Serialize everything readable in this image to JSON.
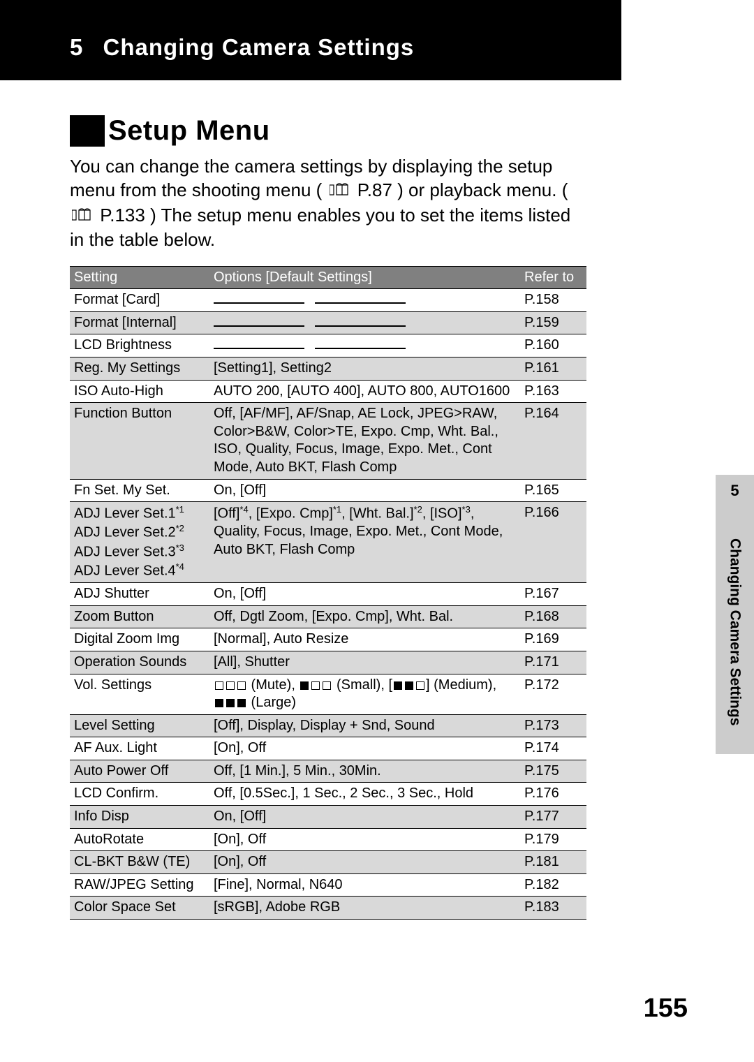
{
  "chapter": {
    "number": "5",
    "title": "Changing Camera Settings"
  },
  "section": {
    "title": "Setup Menu"
  },
  "intro": {
    "part1": "You can change the camera settings by displaying the setup menu from the shooting menu (",
    "ref1": "P.87",
    "part2": ") or playback menu. (",
    "ref2": "P.133",
    "part3": ") The setup menu enables you to set the items listed in the table below."
  },
  "table": {
    "headers": {
      "setting": "Setting",
      "options": "Options [Default Settings]",
      "refer": "Refer to"
    },
    "rows": [
      {
        "setting": "Format [Card]",
        "options": "__dash__",
        "refer": "P.158"
      },
      {
        "setting": "Format [Internal]",
        "options": "__dash__",
        "refer": "P.159"
      },
      {
        "setting": "LCD Brightness",
        "options": "__dash__",
        "refer": "P.160"
      },
      {
        "setting": "Reg. My Settings",
        "options": "[Setting1], Setting2",
        "refer": "P.161"
      },
      {
        "setting": "ISO Auto-High",
        "options": "AUTO 200, [AUTO 400], AUTO 800, AUTO1600",
        "refer": "P.163"
      },
      {
        "setting": "Function Button",
        "options": "Off, [AF/MF], AF/Snap, AE Lock, JPEG>RAW, Color>B&W, Color>TE, Expo. Cmp, Wht. Bal., ISO, Quality, Focus, Image, Expo. Met., Cont Mode, Auto BKT, Flash Comp",
        "refer": "P.164"
      },
      {
        "setting": "Fn Set. My Set.",
        "options": "On, [Off]",
        "refer": "P.165"
      },
      {
        "setting_html": "ADJ Lever Set.1<span class='sup'>*1</span><br>ADJ Lever Set.2<span class='sup'>*2</span><br>ADJ Lever Set.3<span class='sup'>*3</span><br>ADJ Lever Set.4<span class='sup'>*4</span>",
        "options_html": "[Off]<span class='sup'>*4</span>, [Expo. Cmp]<span class='sup'>*1</span>, [Wht. Bal.]<span class='sup'>*2</span>, [ISO]<span class='sup'>*3</span>, Quality, Focus, Image, Expo. Met., Cont Mode, Auto BKT, Flash Comp",
        "refer": "P.166"
      },
      {
        "setting": "ADJ Shutter",
        "options": "On, [Off]",
        "refer": "P.167"
      },
      {
        "setting": "Zoom Button",
        "options": "Off, Dgtl Zoom, [Expo. Cmp], Wht. Bal.",
        "refer": "P.168"
      },
      {
        "setting": "Digital Zoom Img",
        "options": "[Normal], Auto Resize",
        "refer": "P.169"
      },
      {
        "setting": "Operation Sounds",
        "options": "[All], Shutter",
        "refer": "P.171"
      },
      {
        "setting": "Vol. Settings",
        "options": "__vol__",
        "refer": "P.172",
        "vol_labels": {
          "mute": "(Mute),",
          "small": "(Small),",
          "medium": "(Medium),",
          "large": "(Large)"
        }
      },
      {
        "setting": "Level Setting",
        "options": "[Off], Display, Display + Snd, Sound",
        "refer": "P.173"
      },
      {
        "setting": "AF Aux. Light",
        "options": "[On], Off",
        "refer": "P.174"
      },
      {
        "setting": "Auto Power Off",
        "options": "Off, [1 Min.], 5 Min., 30Min.",
        "refer": "P.175"
      },
      {
        "setting": "LCD Confirm.",
        "options": "Off, [0.5Sec.], 1 Sec., 2 Sec., 3 Sec., Hold",
        "refer": "P.176"
      },
      {
        "setting": "Info Disp",
        "options": "On, [Off]",
        "refer": "P.177"
      },
      {
        "setting": "AutoRotate",
        "options": "[On], Off",
        "refer": "P.179"
      },
      {
        "setting": "CL-BKT B&W (TE)",
        "options": "[On], Off",
        "refer": "P.181"
      },
      {
        "setting": "RAW/JPEG Setting",
        "options": "[Fine], Normal, N640",
        "refer": "P.182"
      },
      {
        "setting": "Color Space Set",
        "options": "[sRGB], Adobe RGB",
        "refer": "P.183"
      }
    ]
  },
  "side_tab": {
    "number": "5",
    "text": "Changing Camera Settings"
  },
  "page_number": "155"
}
